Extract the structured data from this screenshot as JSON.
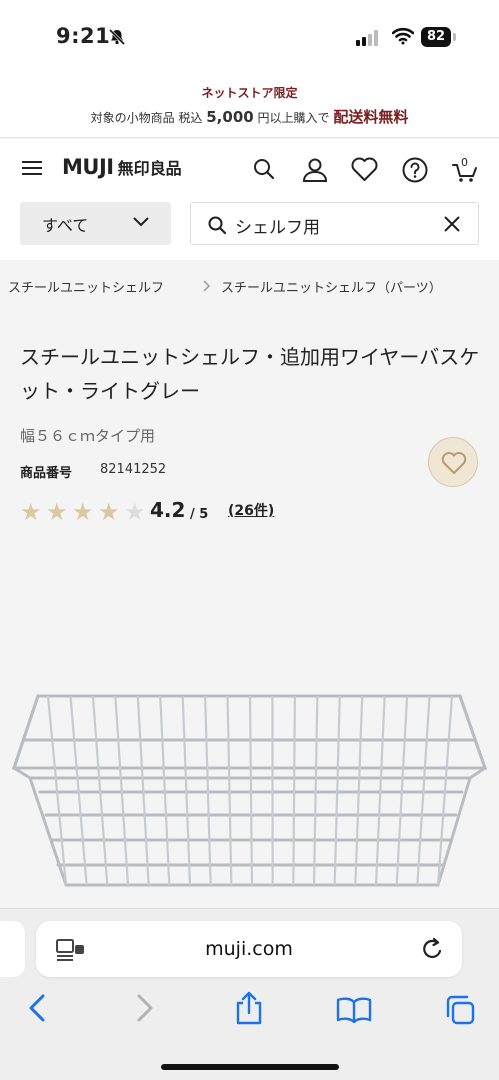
{
  "status": {
    "time": "9:21",
    "battery": "82"
  },
  "promo": {
    "line1": "ネットストア限定",
    "line2_prefix": "対象の小物商品 税込",
    "line2_amount": "5,000",
    "line2_suffix": "円以上購入で",
    "line2_free": "配送料無料"
  },
  "header": {
    "logo_text": "MUJI",
    "logo_jp": "無印良品",
    "cart_count": "0"
  },
  "search": {
    "category_label": "すべて",
    "query": "シェルフ用"
  },
  "breadcrumb": {
    "items": [
      "スチールユニットシェルフ",
      "スチールユニットシェルフ（パーツ）"
    ]
  },
  "product": {
    "title": "スチールユニットシェルフ・追加用ワイヤーバスケット・ライトグレー",
    "subtitle": "幅５６ｃｍタイプ用",
    "code_label": "商品番号",
    "code": "82141252",
    "rating_value": 4.2,
    "rating": "4.2",
    "rating_max": "/ 5",
    "review_count": "(26件)"
  },
  "browser": {
    "url": "muji.com"
  },
  "colors": {
    "accent_red": "#7b1e1e",
    "star_filled": "#d9c9a3",
    "star_empty": "#dddddd",
    "link_blue": "#1a73e8"
  }
}
